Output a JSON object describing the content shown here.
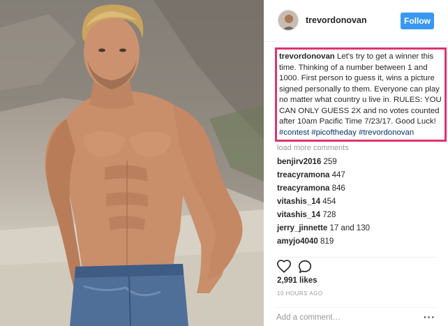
{
  "post": {
    "username": "trevordonovan",
    "follow_label": "Follow",
    "caption": {
      "user": "trevordonovan",
      "text": " Let's try to get a winner this time. Thinking of a number between 1 and 1000. First person to guess it, wins a picture signed personally to them. Everyone can play no matter what country u live in. RULES: YOU CAN ONLY GUESS 2X and no votes counted after 10am Pacific Time 7/23/17. Good Luck! ",
      "hashtags": [
        "#contest",
        "#picoftheday",
        "#trevordonovan"
      ]
    },
    "load_more_label": "load more comments",
    "comments": [
      {
        "user": "benjirv2016",
        "text": "259"
      },
      {
        "user": "treacyramona",
        "text": "447"
      },
      {
        "user": "treacyramona",
        "text": "846"
      },
      {
        "user": "vitashis_14",
        "text": "454"
      },
      {
        "user": "vitashis_14",
        "text": "728"
      },
      {
        "user": "jerry_jinnette",
        "text": "17 and 130"
      },
      {
        "user": "amyjo4040",
        "text": "819"
      }
    ],
    "likes_label": "2,991 likes",
    "timestamp": "10 HOURS AGO",
    "add_comment_placeholder": "Add a comment…",
    "more_label": "···"
  },
  "icons": {
    "like": "heart-outline-icon",
    "comment": "speech-bubble-icon",
    "more": "ellipsis-icon"
  },
  "colors": {
    "follow_bg": "#3897f0",
    "highlight_border": "#e0336f",
    "hashtag": "#003569",
    "muted": "#999999"
  }
}
